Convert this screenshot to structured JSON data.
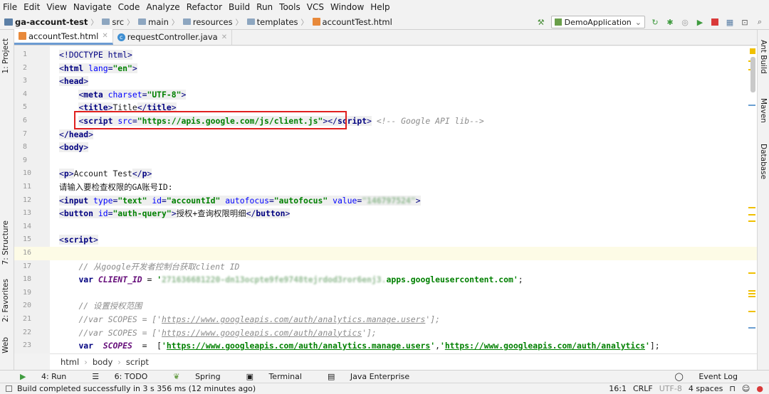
{
  "menu": [
    "File",
    "Edit",
    "View",
    "Navigate",
    "Code",
    "Analyze",
    "Refactor",
    "Build",
    "Run",
    "Tools",
    "VCS",
    "Window",
    "Help"
  ],
  "breadcrumb": {
    "project": "ga-account-test",
    "items": [
      "src",
      "main",
      "resources",
      "templates"
    ],
    "file": "accountTest.html"
  },
  "run_config": "DemoApplication",
  "tabs": [
    {
      "label": "accountTest.html",
      "active": true
    },
    {
      "label": "requestController.java",
      "active": false
    }
  ],
  "left_tools": [
    "1: Project",
    "7: Structure",
    "2: Favorites",
    "Web"
  ],
  "right_tools": [
    "Ant Build",
    "Maven",
    "Database"
  ],
  "code": {
    "line_numbers": [
      "1",
      "2",
      "3",
      "4",
      "5",
      "6",
      "7",
      "8",
      "9",
      "10",
      "11",
      "12",
      "13",
      "14",
      "15",
      "16",
      "17",
      "18",
      "19",
      "20",
      "21",
      "22",
      "23"
    ],
    "l1": "<!DOCTYPE html>",
    "l2_tag": "html",
    "l2_attr": "lang",
    "l2_val": "\"en\"",
    "l3_tag": "head",
    "l4_tag": "meta",
    "l4_attr": "charset",
    "l4_val": "\"UTF-8\"",
    "l5_tag": "title",
    "l5_text": "Title",
    "l6_tag": "script",
    "l6_attr": "src",
    "l6_val": "\"https://apis.google.com/js/client.js\"",
    "l6_comment": "<!-- Google API lib-->",
    "l7_tag": "/head",
    "l8_tag": "body",
    "l10_tag": "p",
    "l10_text": "Account Test",
    "l11_text": "请输入要检查权限的GA账号ID:",
    "l12_tag": "input",
    "l12_a1": "type",
    "l12_v1": "\"text\"",
    "l12_a2": "id",
    "l12_v2": "\"accountId\"",
    "l12_a3": "autofocus",
    "l12_v3": "\"autofocus\"",
    "l12_a4": "value",
    "l12_v4": "\"146797524\"",
    "l13_tag": "button",
    "l13_attr": "id",
    "l13_val": "\"auth-query\"",
    "l13_text": "授权+查询权限明细",
    "l15_tag": "script",
    "l17_comment": "// 从google开发者控制台获取client ID",
    "l18_kw": "var",
    "l18_var": "CLIENT_ID",
    "l18_blur": "271636681220-dn13ocpte9fe9748tejrdod3ror6enj3.",
    "l18_str": "apps.googleusercontent.com",
    "l20_comment": "// 设置授权范围",
    "l21_prefix": "//var SCOPES = ['",
    "l21_url": "https://www.googleapis.com/auth/analytics.manage.users",
    "l21_suffix": "'];",
    "l22_prefix": "//var SCOPES = ['",
    "l22_url": "https://www.googleapis.com/auth/analytics",
    "l22_suffix": "'];",
    "l23_kw": "var",
    "l23_var": "SCOPES",
    "l23_url1": "https://www.googleapis.com/auth/analytics.manage.users",
    "l23_url2": "https://www.googleapis.com/auth/analytics"
  },
  "editor_breadcrumb": [
    "html",
    "body",
    "script"
  ],
  "tool_windows": [
    "4: Run",
    "6: TODO",
    "Spring",
    "Terminal",
    "Java Enterprise"
  ],
  "event_log": "Event Log",
  "status": {
    "message": "Build completed successfully in 3 s 356 ms (12 minutes ago)",
    "position": "16:1",
    "line_sep": "CRLF",
    "encoding": "UTF-8",
    "indent": "4 spaces"
  }
}
